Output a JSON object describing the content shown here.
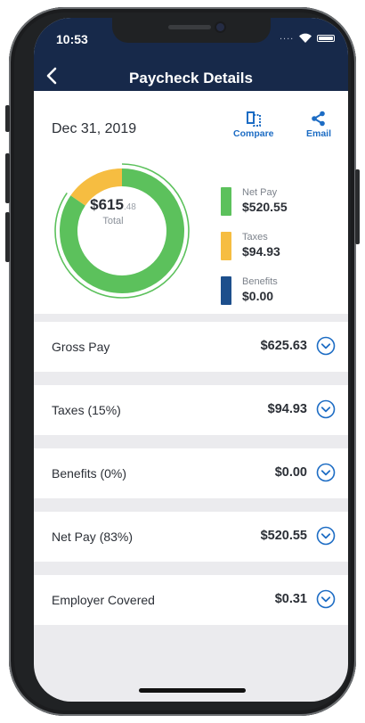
{
  "status_bar": {
    "time": "10:53",
    "signal": "...."
  },
  "nav": {
    "title": "Paycheck Details"
  },
  "summary": {
    "date": "Dec 31, 2019",
    "compare_label": "Compare",
    "email_label": "Email",
    "total_dollars": "$615",
    "total_cents": ".48",
    "total_label": "Total"
  },
  "legend": [
    {
      "label": "Net Pay",
      "amount": "$520.55",
      "color": "#5cc15c"
    },
    {
      "label": "Taxes",
      "amount": "$94.93",
      "color": "#f6bd41"
    },
    {
      "label": "Benefits",
      "amount": "$0.00",
      "color": "#1d4f8c"
    }
  ],
  "chart_data": {
    "type": "pie",
    "categories": [
      "Net Pay",
      "Taxes",
      "Benefits"
    ],
    "values": [
      520.55,
      94.93,
      0.0
    ],
    "colors": [
      "#5cc15c",
      "#f6bd41",
      "#1d4f8c"
    ],
    "center_text": "$615.48",
    "center_label": "Total"
  },
  "rows": [
    {
      "label": "Gross Pay",
      "value": "$625.63"
    },
    {
      "label": "Taxes (15%)",
      "value": "$94.93"
    },
    {
      "label": "Benefits (0%)",
      "value": "$0.00"
    },
    {
      "label": "Net Pay (83%)",
      "value": "$520.55"
    },
    {
      "label": "Employer Covered",
      "value": "$0.31"
    }
  ],
  "icons": {
    "back": "chevron-left-icon",
    "compare": "compare-icon",
    "email": "share-icon",
    "expand": "chevron-down-circle-icon"
  },
  "colors": {
    "nav_bg": "#17294a",
    "accent": "#1c6cc4",
    "net_pay": "#5cc15c",
    "taxes": "#f6bd41",
    "benefits": "#1d4f8c"
  }
}
